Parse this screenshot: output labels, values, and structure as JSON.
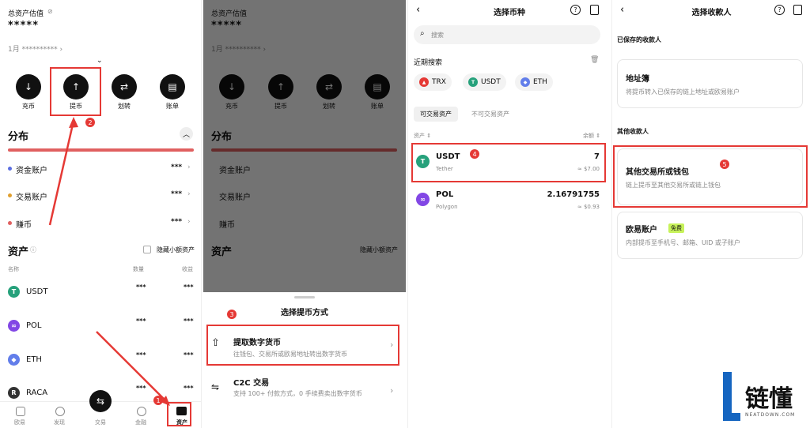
{
  "p1": {
    "total_label": "总资产估值",
    "stars": "*****",
    "month_line": "1月 ********** ›",
    "actions": [
      {
        "label": "充币",
        "icon": "↓"
      },
      {
        "label": "提币",
        "icon": "↑"
      },
      {
        "label": "划转",
        "icon": "⇄"
      },
      {
        "label": "账单",
        "icon": "▤"
      }
    ],
    "dist_title": "分布",
    "accounts": [
      {
        "name": "资金账户",
        "color": "#5b6ee1",
        "value": "***"
      },
      {
        "name": "交易账户",
        "color": "#e0a030",
        "value": "***"
      },
      {
        "name": "赚币",
        "color": "#e06060",
        "value": "***"
      }
    ],
    "assets_title": "资产",
    "hide_small": "隐藏小额资产",
    "col_name": "名称",
    "col_qty": "数量",
    "col_income": "收益",
    "coins": [
      {
        "name": "USDT",
        "color": "#26a17b",
        "glyph": "T",
        "v1": "***",
        "v2": "***"
      },
      {
        "name": "POL",
        "color": "#8247e5",
        "glyph": "∞",
        "v1": "***",
        "v2": "***"
      },
      {
        "name": "ETH",
        "color": "#627eea",
        "glyph": "◆",
        "v1": "***",
        "v2": "***"
      },
      {
        "name": "RACA",
        "color": "#333",
        "glyph": "R",
        "v1": "***",
        "v2": "***"
      }
    ],
    "nav": [
      "欧易",
      "发现",
      "交易",
      "金融",
      "资产"
    ],
    "badge1": "1",
    "badge2": "2"
  },
  "p2": {
    "sheet_title": "选择提币方式",
    "opt1_title": "提取数字货币",
    "opt1_sub": "往钱包、交易所或欧易地址转出数字货币",
    "opt2_title": "C2C 交易",
    "opt2_sub": "支持 100+ 付款方式，0 手续费卖出数字货币",
    "badge3": "3"
  },
  "p3": {
    "title": "选择币种",
    "search_placeholder": "搜索",
    "recent": "近期搜索",
    "chips": [
      {
        "name": "TRX",
        "color": "#e53935",
        "glyph": "▲"
      },
      {
        "name": "USDT",
        "color": "#26a17b",
        "glyph": "T"
      },
      {
        "name": "ETH",
        "color": "#627eea",
        "glyph": "◆"
      }
    ],
    "tab1": "可交易资产",
    "tab2": "不可交易资产",
    "col_asset": "资产 ⇕",
    "col_bal": "余额 ⇕",
    "rows": [
      {
        "sym": "USDT",
        "name": "Tether",
        "amount": "7",
        "usd": "≈ $7.00",
        "color": "#26a17b",
        "glyph": "T"
      },
      {
        "sym": "POL",
        "name": "Polygon",
        "amount": "2.16791755",
        "usd": "≈ $0.93",
        "color": "#8247e5",
        "glyph": "∞"
      }
    ],
    "badge4": "4"
  },
  "p4": {
    "title": "选择收款人",
    "saved": "已保存的收款人",
    "addr_title": "地址簿",
    "addr_sub": "将提币转入已保存的链上地址或欧易账户",
    "other": "其他收款人",
    "ex_title": "其他交易所或钱包",
    "ex_sub": "链上提币至其他交易所或链上钱包",
    "okx_title": "欧易账户",
    "okx_tag": "免费",
    "okx_sub": "内部提币至手机号、邮箱、UID 或子账户",
    "badge5": "5"
  },
  "logo": {
    "cn": "链懂",
    "en": "NEATDOWN.COM"
  },
  "colors": {
    "red": "#e53935",
    "black": "#111"
  }
}
